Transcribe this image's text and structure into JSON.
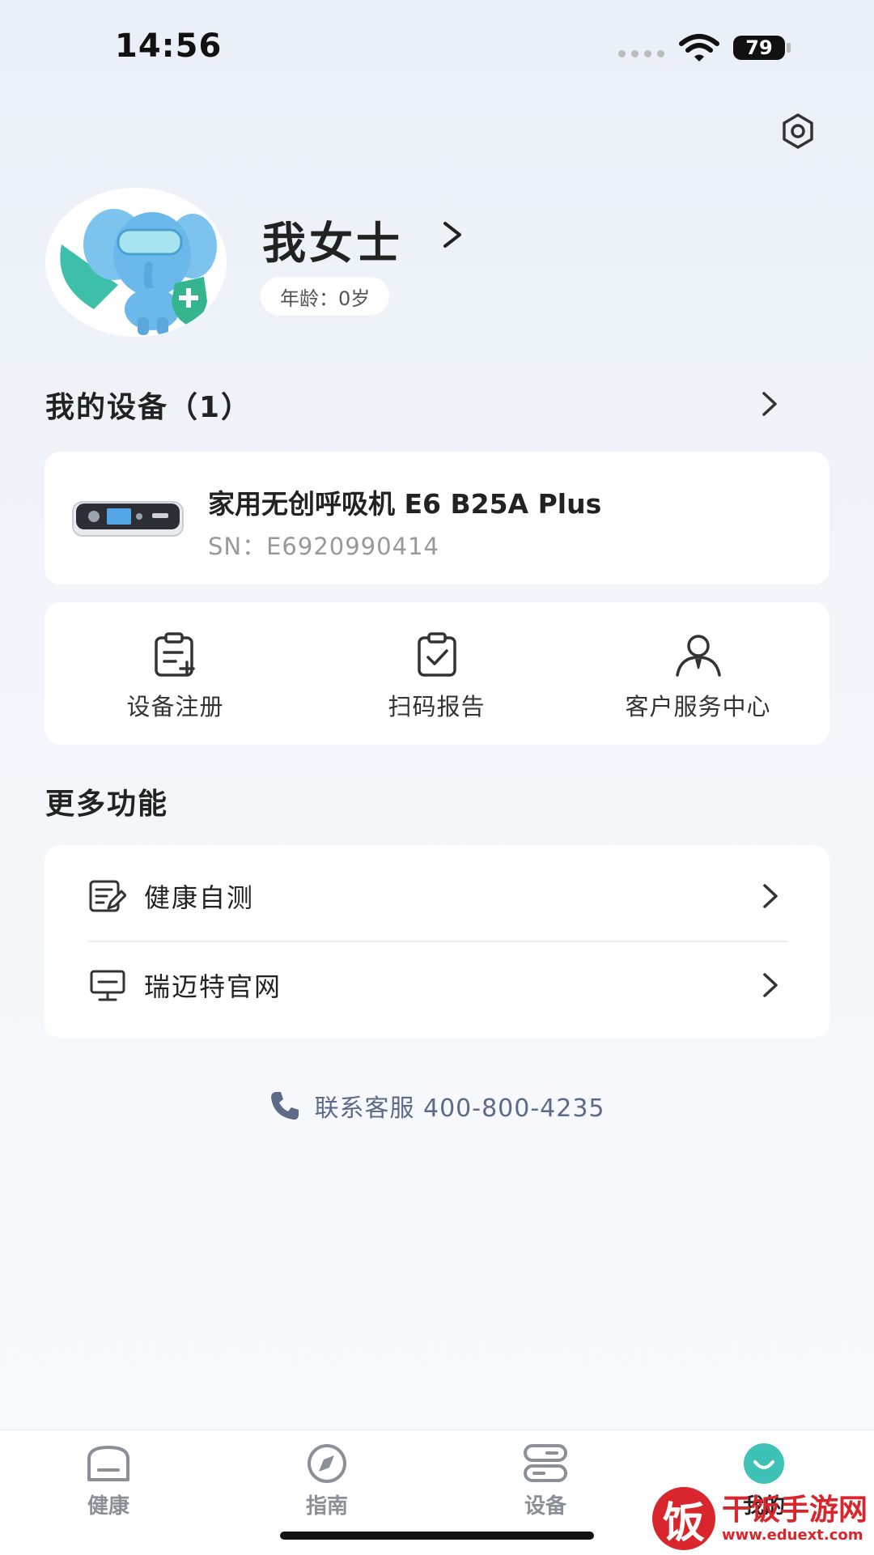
{
  "status_bar": {
    "time": "14:56",
    "battery": "79"
  },
  "profile": {
    "name": "我女士",
    "age": "年龄：0岁"
  },
  "devices": {
    "title": "我的设备（1）",
    "items": [
      {
        "name": "家用无创呼吸机 E6 B25A Plus",
        "sn": "SN：E6920990414"
      }
    ]
  },
  "actions": [
    {
      "label": "设备注册",
      "icon": "clipboard-add-icon"
    },
    {
      "label": "扫码报告",
      "icon": "clipboard-check-icon"
    },
    {
      "label": "客户服务中心",
      "icon": "person-icon"
    }
  ],
  "more": {
    "title": "更多功能",
    "items": [
      {
        "label": "健康自测",
        "icon": "edit-note-icon"
      },
      {
        "label": "瑞迈特官网",
        "icon": "monitor-icon"
      }
    ]
  },
  "contact": {
    "text": "联系客服 400-800-4235",
    "icon": "phone-icon"
  },
  "tabbar": {
    "items": [
      {
        "label": "健康",
        "icon": "health-icon"
      },
      {
        "label": "指南",
        "icon": "compass-icon"
      },
      {
        "label": "设备",
        "icon": "device-icon"
      },
      {
        "label": "我的",
        "icon": "smile-icon",
        "active": true
      }
    ]
  },
  "watermark": {
    "glyph": "饭",
    "title": "干饭手游网",
    "url": "www.eduext.com"
  },
  "colors": {
    "accent": "#3ec2b6",
    "text": "#222222",
    "muted": "#999999",
    "watermark": "#d8262c"
  }
}
